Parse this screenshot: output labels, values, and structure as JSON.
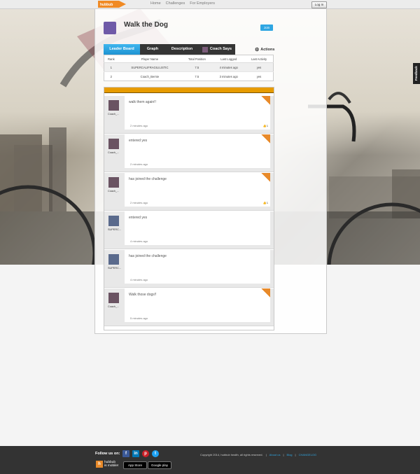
{
  "header": {
    "logo_text": "hubbub",
    "nav": [
      "Home",
      "Challenges",
      "For Employers"
    ],
    "login_label": "Log In"
  },
  "challenge": {
    "title": "Walk the Dog",
    "join_label": "Join"
  },
  "tabs": [
    {
      "label": "Leader Board"
    },
    {
      "label": "Graph"
    },
    {
      "label": "Description"
    },
    {
      "label": "Coach Says"
    }
  ],
  "actions_label": "Actions",
  "leaderboard": {
    "columns": [
      "Rank",
      "Player Name",
      "Total Position",
      "Last Logged",
      "Last Activity"
    ],
    "rows": [
      [
        "1",
        "SUPERCALIFRAGILILISTIC",
        "7.5",
        "4 minutes ago",
        "yes"
      ],
      [
        "2",
        "Coach_Bernie",
        "7.5",
        "3 minutes ago",
        "yes"
      ]
    ]
  },
  "feed": [
    {
      "user": "Coach_...",
      "message": "walk them again!!",
      "time": "2 minutes ago",
      "likes": "1",
      "avatar": "coach"
    },
    {
      "user": "Coach_...",
      "message": "entered yes",
      "time": "2 minutes ago",
      "likes": "",
      "avatar": "coach"
    },
    {
      "user": "Coach_...",
      "message": "has joined the challenge",
      "time": "2 minutes ago",
      "likes": "1",
      "avatar": "coach"
    },
    {
      "user": "SUPERC...",
      "message": "entered yes",
      "time": "4 minutes ago",
      "likes": "",
      "avatar": "super"
    },
    {
      "user": "SUPERC...",
      "message": "has joined the challenge",
      "time": "4 minutes ago",
      "likes": "",
      "avatar": "super"
    },
    {
      "user": "Coach_...",
      "message": "Walk those dogs!!",
      "time": "5 minutes ago",
      "likes": "",
      "avatar": "coach"
    }
  ],
  "feedback_label": "Feedback",
  "footer": {
    "follow_label": "Follow us on:",
    "social": [
      "f",
      "in",
      "p",
      "t"
    ],
    "mobile_text_1": "hubbub",
    "mobile_text_2": "is mobile!",
    "app_store": "App Store",
    "google_play": "Google play",
    "copyright": "Copyright 2014, hubbub health, all rights reserved.",
    "links": [
      "About us",
      "Blog",
      "CHANGELOG"
    ]
  },
  "colors": {
    "accent_blue": "#2fa6e2",
    "accent_orange": "#e79b00",
    "tab_dark": "#353535"
  }
}
